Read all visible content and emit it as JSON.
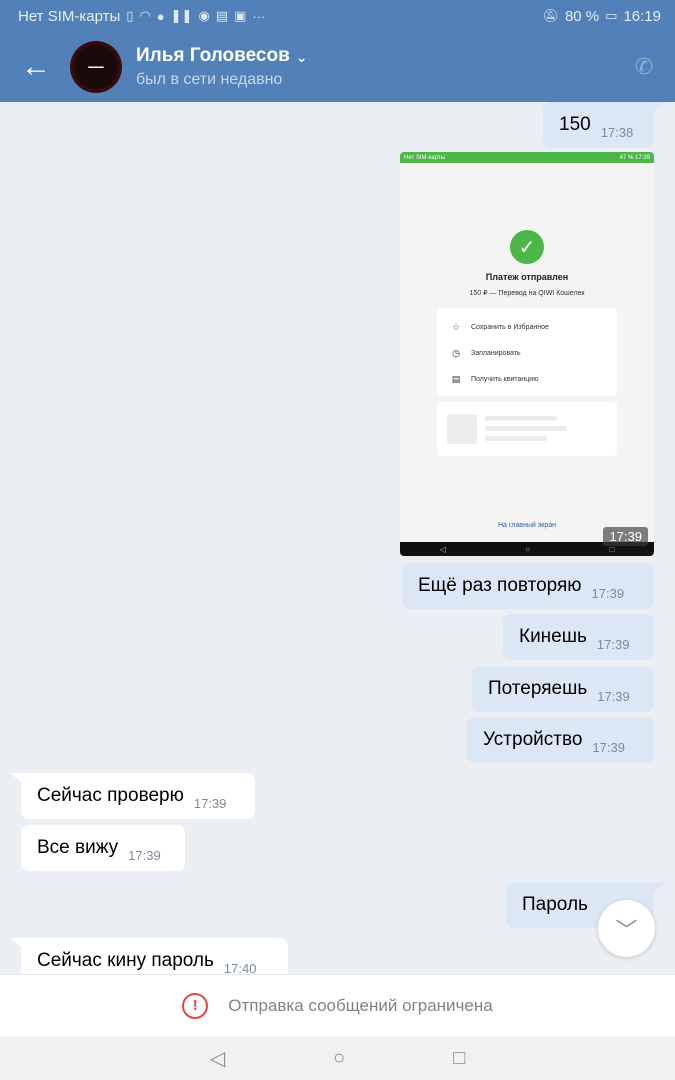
{
  "status_bar": {
    "carrier": "Нет SIM-карты",
    "battery": "80 %",
    "time": "16:19"
  },
  "header": {
    "contact_name": "Илья Головесов",
    "last_seen": "был в сети недавно",
    "icons": [
      "back-arrow-icon",
      "chevron-down-icon",
      "phone-icon"
    ]
  },
  "messages": [
    {
      "dir": "out",
      "text": "150",
      "time": "17:38"
    },
    {
      "dir": "out",
      "type": "image",
      "time": "17:39"
    },
    {
      "dir": "out",
      "text": "Ещё раз повторяю",
      "time": "17:39"
    },
    {
      "dir": "out",
      "text": "Кинешь",
      "time": "17:39"
    },
    {
      "dir": "out",
      "text": "Потеряешь",
      "time": "17:39"
    },
    {
      "dir": "out",
      "text": "Устройство",
      "time": "17:39"
    },
    {
      "dir": "in",
      "text": "Сейчас проверю",
      "time": "17:39"
    },
    {
      "dir": "in",
      "text": "Все вижу",
      "time": "17:39"
    },
    {
      "dir": "out",
      "text": "Пароль",
      "time": ""
    },
    {
      "dir": "in",
      "text": "Сейчас кину пароль",
      "time": "17:40"
    }
  ],
  "screenshot": {
    "status_left": "Нет SIM-карты",
    "status_right": "47 %  17:39",
    "title": "Платеж отправлен",
    "subtitle": "150 ₽ — Перевод на QIWI Кошелек",
    "actions": [
      "Сохранить в Избранное",
      "Запланировать",
      "Получить квитанцию"
    ],
    "link": "На главный экран"
  },
  "footer": {
    "restriction_text": "Отправка сообщений ограничена",
    "accent_color": "#e64646"
  },
  "colors": {
    "header_bg": "#5181b8",
    "outgoing_bubble": "#dce7f5",
    "incoming_bubble": "#ffffff",
    "chat_bg": "#ebeef2"
  }
}
